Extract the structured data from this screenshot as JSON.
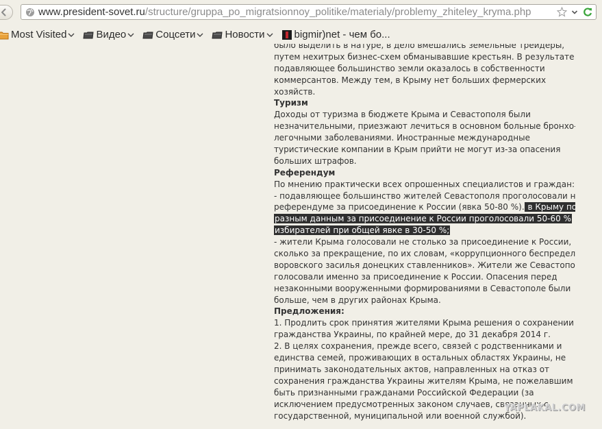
{
  "browser": {
    "url_domain": "www.president-sovet.ru",
    "url_path": "/structure/gruppa_po_migratsionnoy_politike/materialy/problemy_zhiteley_kryma.php",
    "url_scheme_prefix": "",
    "icons": {
      "back": "back-arrow-icon",
      "site": "globe-icon",
      "bookmark_star": "star-icon",
      "dropdown": "chevron-down-icon",
      "reload": "reload-icon"
    }
  },
  "bookmarks": [
    {
      "label": "Most Visited",
      "icon": "folder-icon",
      "has_chevron": true
    },
    {
      "label": "Видео",
      "icon": "folder-icon",
      "has_chevron": true
    },
    {
      "label": "Соцсети",
      "icon": "folder-icon",
      "has_chevron": true
    },
    {
      "label": "Новости",
      "icon": "folder-icon",
      "has_chevron": true
    },
    {
      "label": "bigmir)net - чем бо...",
      "icon": "site-favicon",
      "has_chevron": false
    }
  ],
  "article": {
    "lines": [
      {
        "text": "было выделить в натуре, в дело вмешались земельные трейдеры,",
        "type": "text"
      },
      {
        "text": "путем нехитрых бизнес-схем обманывавшие крестьян. В результате",
        "type": "text"
      },
      {
        "text": "подавляющее большинство земли оказалось в собственности",
        "type": "text"
      },
      {
        "text": "коммерсантов. Между тем, в Крыму нет больших фермерских",
        "type": "text"
      },
      {
        "text": "хозяйств.",
        "type": "text"
      },
      {
        "text": "Туризм",
        "type": "heading"
      },
      {
        "text": "Доходы от туризма в бюджете Крыма и Севастополя были",
        "type": "text"
      },
      {
        "text": "незначительными, приезжают лечиться в основном больные бронхо-",
        "type": "text"
      },
      {
        "text": "легочными заболеваниями. Иностранные международные",
        "type": "text"
      },
      {
        "text": "туристические компании в Крым прийти не могут из-за опасения",
        "type": "text"
      },
      {
        "text": "больших штрафов.",
        "type": "text"
      },
      {
        "text": "Референдум",
        "type": "heading"
      },
      {
        "text": "По мнению практически всех опрошенных специалистов и граждан:",
        "type": "text"
      },
      {
        "text": "- подавляющее большинство жителей Севастополя проголосовали на",
        "type": "text"
      },
      {
        "text": "референдуме за присоединение к России (явка 50-80 %).",
        "type": "mixed",
        "highlight": " в Крыму по"
      },
      {
        "text": "",
        "type": "highlight",
        "highlight": "разным данным за присоединение к России проголосовали 50-60 %"
      },
      {
        "text": "",
        "type": "highlight",
        "highlight": "избирателей при общей явке в 30-50 %;"
      },
      {
        "text": "- жители Крыма голосовали не столько за присоединение к России,",
        "type": "text"
      },
      {
        "text": "сколько за прекращение, по их словам, «коррупционного беспредела и",
        "type": "text"
      },
      {
        "text": "воровского засилья донецких ставленников». Жители же Севастополя",
        "type": "text"
      },
      {
        "text": "голосовали именно за присоединение к России. Опасения перед",
        "type": "text"
      },
      {
        "text": "незаконными вооруженными формированиями в Севастополе были",
        "type": "text"
      },
      {
        "text": "больше, чем в других районах Крыма.",
        "type": "text"
      },
      {
        "text": "Предложения:",
        "type": "heading"
      },
      {
        "text": "1. Продлить срок принятия жителями Крыма решения о сохранении",
        "type": "text"
      },
      {
        "text": "гражданства Украины, по крайней мере, до 31 декабря 2014 г.",
        "type": "text"
      },
      {
        "text": "2. В целях сохранения, прежде всего, связей с родственниками и",
        "type": "text"
      },
      {
        "text": "единства семей, проживающих в остальных областях Украины, не",
        "type": "text"
      },
      {
        "text": "принимать законодательных актов, направленных на отказ от",
        "type": "text"
      },
      {
        "text": "сохранения гражданства Украины жителям Крыма, не пожелавшим",
        "type": "text"
      },
      {
        "text": "быть признанными гражданами Российской Федерации (за",
        "type": "text"
      },
      {
        "text": "исключением предусмотренных законом случаев, связанных с",
        "type": "text"
      },
      {
        "text": "государственной, муниципальной или военной службой).",
        "type": "text"
      }
    ]
  },
  "watermark": {
    "text": "YAPLAKAL.COM"
  },
  "colors": {
    "chrome_bg": "#f1efe7",
    "text": "#333333",
    "highlight_bg": "#2f2f2f",
    "highlight_fg": "#ffffff"
  }
}
